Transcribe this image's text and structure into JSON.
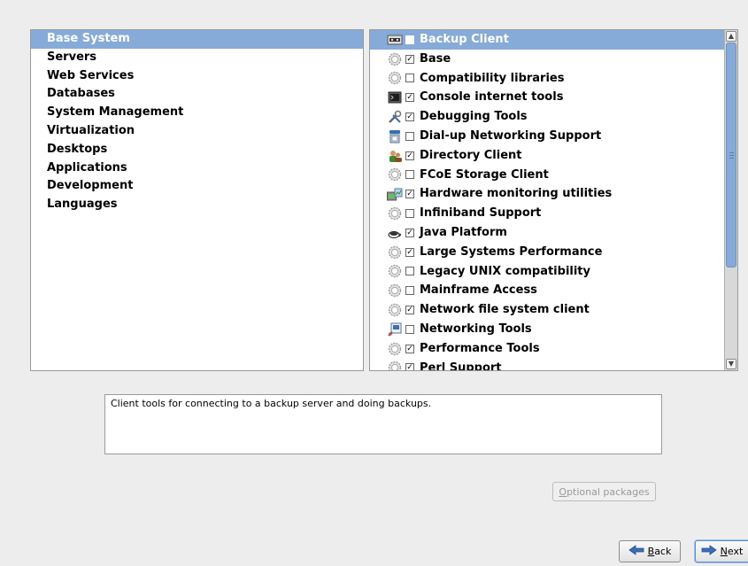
{
  "categories": [
    {
      "label": "Base System",
      "selected": true
    },
    {
      "label": "Servers",
      "selected": false
    },
    {
      "label": "Web Services",
      "selected": false
    },
    {
      "label": "Databases",
      "selected": false
    },
    {
      "label": "System Management",
      "selected": false
    },
    {
      "label": "Virtualization",
      "selected": false
    },
    {
      "label": "Desktops",
      "selected": false
    },
    {
      "label": "Applications",
      "selected": false
    },
    {
      "label": "Development",
      "selected": false
    },
    {
      "label": "Languages",
      "selected": false
    }
  ],
  "groups": [
    {
      "label": "Backup Client",
      "checked": false,
      "selected": true,
      "icon": "backup-icon"
    },
    {
      "label": "Base",
      "checked": true,
      "selected": false,
      "icon": "gear-icon"
    },
    {
      "label": "Compatibility libraries",
      "checked": false,
      "selected": false,
      "icon": "gear-icon"
    },
    {
      "label": "Console internet tools",
      "checked": true,
      "selected": false,
      "icon": "terminal-icon"
    },
    {
      "label": "Debugging Tools",
      "checked": true,
      "selected": false,
      "icon": "tools-icon"
    },
    {
      "label": "Dial-up Networking Support",
      "checked": false,
      "selected": false,
      "icon": "phone-icon"
    },
    {
      "label": "Directory Client",
      "checked": true,
      "selected": false,
      "icon": "users-icon"
    },
    {
      "label": "FCoE Storage Client",
      "checked": false,
      "selected": false,
      "icon": "gear-icon"
    },
    {
      "label": "Hardware monitoring utilities",
      "checked": true,
      "selected": false,
      "icon": "hardware-monitor-icon"
    },
    {
      "label": "Infiniband Support",
      "checked": false,
      "selected": false,
      "icon": "gear-icon"
    },
    {
      "label": "Java Platform",
      "checked": true,
      "selected": false,
      "icon": "java-cup-icon"
    },
    {
      "label": "Large Systems Performance",
      "checked": true,
      "selected": false,
      "icon": "gear-icon"
    },
    {
      "label": "Legacy UNIX compatibility",
      "checked": false,
      "selected": false,
      "icon": "gear-icon"
    },
    {
      "label": "Mainframe Access",
      "checked": false,
      "selected": false,
      "icon": "gear-icon"
    },
    {
      "label": "Network file system client",
      "checked": true,
      "selected": false,
      "icon": "gear-icon"
    },
    {
      "label": "Networking Tools",
      "checked": false,
      "selected": false,
      "icon": "network-icon"
    },
    {
      "label": "Performance Tools",
      "checked": true,
      "selected": false,
      "icon": "gear-icon"
    },
    {
      "label": "Perl Support",
      "checked": true,
      "selected": false,
      "icon": "gear-icon"
    }
  ],
  "description": "Client tools for connecting to a backup server and doing backups.",
  "buttons": {
    "optional_packages_accel": "O",
    "optional_packages_rest": "ptional packages",
    "back_accel": "B",
    "back_rest": "ack",
    "next_accel": "N",
    "next_rest": "ext"
  },
  "scrollbar": {
    "position": 0.0,
    "visible_fraction": 0.72
  },
  "colors": {
    "selection": "#86abd9",
    "background": "#ededed"
  }
}
